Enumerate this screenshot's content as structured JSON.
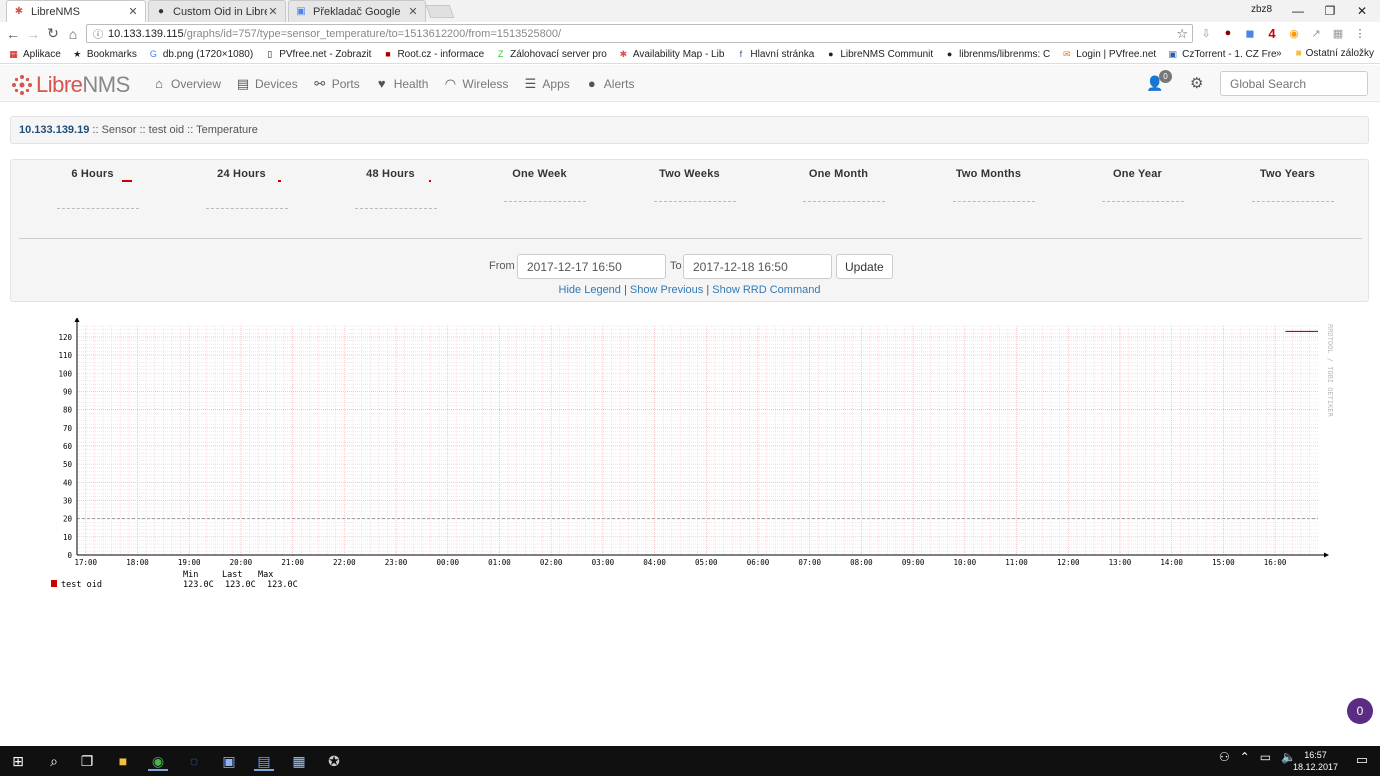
{
  "browser": {
    "tabs": [
      {
        "label": "LibreNMS",
        "icon": "librenms-favicon"
      },
      {
        "label": "Custom Oid in LibreNMS",
        "icon": "github-icon"
      },
      {
        "label": "Překladač Google",
        "icon": "google-translate-icon"
      }
    ],
    "profile": "zbz8",
    "url_host": "10.133.139.115",
    "url_path": "/graphs/id=757/type=sensor_temperature/to=1513612200/from=1513525800/",
    "ext_badge": "4",
    "bookmarks": [
      "Aplikace",
      "Bookmarks",
      "db.png (1720×1080)",
      "PVfree.net - Zobrazit",
      "Root.cz - informace",
      "Zálohovací server pro",
      "Availability Map - Lib",
      "Hlavní stránka",
      "LibreNMS Communit",
      "librenms/librenms: C",
      "Login | PVfree.net",
      "CzTorrent - 1. CZ Fre"
    ],
    "other_bookmarks": "Ostatní záložky"
  },
  "nav": {
    "logo_a": "Libre",
    "logo_b": "NMS",
    "items": [
      "Overview",
      "Devices",
      "Ports",
      "Health",
      "Wireless",
      "Apps",
      "Alerts"
    ],
    "user_badge": "0",
    "search_placeholder": "Global Search"
  },
  "breadcrumb": {
    "device": "10.133.139.19",
    "rest": " :: Sensor :: test oid :: Temperature"
  },
  "periods": [
    "6 Hours",
    "24 Hours",
    "48 Hours",
    "One Week",
    "Two Weeks",
    "One Month",
    "Two Months",
    "One Year",
    "Two Years"
  ],
  "range": {
    "from_label": "From",
    "from_value": "2017-12-17 16:50",
    "to_label": "To",
    "to_value": "2017-12-18 16:50",
    "update": "Update"
  },
  "links": {
    "hide_legend": "Hide Legend",
    "show_previous": "Show Previous",
    "show_rrd": "Show RRD Command"
  },
  "legend": {
    "hdr_min": "Min",
    "hdr_last": "Last",
    "hdr_max": "Max",
    "name": "test oid",
    "min": "123.0C",
    "last": "123.0C",
    "max": "123.0C"
  },
  "watermark": "RRDTOOL / TOBI OETIKER",
  "bubble_count": "0",
  "taskbar": {
    "time": "16:57",
    "date": "18.12.2017"
  },
  "chart_data": {
    "type": "line",
    "xlabel": "",
    "ylabel": "",
    "x_ticks": [
      "17:00",
      "18:00",
      "19:00",
      "20:00",
      "21:00",
      "22:00",
      "23:00",
      "00:00",
      "01:00",
      "02:00",
      "03:00",
      "04:00",
      "05:00",
      "06:00",
      "07:00",
      "08:00",
      "09:00",
      "10:00",
      "11:00",
      "12:00",
      "13:00",
      "14:00",
      "15:00",
      "16:00"
    ],
    "y_ticks": [
      0,
      10,
      20,
      30,
      40,
      50,
      60,
      70,
      80,
      90,
      100,
      110,
      120
    ],
    "ylim": [
      0,
      126
    ],
    "xlim_hours": [
      16.83,
      40.83
    ],
    "threshold": 20,
    "series": [
      {
        "name": "test oid",
        "color": "#cc0000",
        "x_hours": [
          40.2,
          40.83
        ],
        "values": [
          123,
          123
        ]
      }
    ],
    "grid": true
  }
}
